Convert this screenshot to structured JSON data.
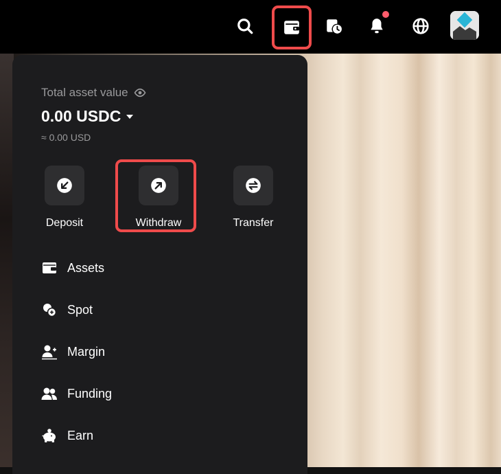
{
  "topbar": {
    "icons": [
      "search-icon",
      "wallet-icon",
      "order-history-icon",
      "notification-bell-icon",
      "globe-icon",
      "avatar"
    ],
    "notification_dot_color": "#ff5c6c",
    "highlight_color": "#ef4b4b"
  },
  "wallet": {
    "total_label": "Total asset value",
    "balance": "0.00 USDC",
    "approx": "≈ 0.00 USD"
  },
  "actions": [
    {
      "label": "Deposit",
      "icon": "deposit-icon"
    },
    {
      "label": "Withdraw",
      "icon": "withdraw-icon"
    },
    {
      "label": "Transfer",
      "icon": "transfer-icon"
    }
  ],
  "menu": [
    {
      "label": "Assets",
      "icon": "assets-icon"
    },
    {
      "label": "Spot",
      "icon": "spot-icon"
    },
    {
      "label": "Margin",
      "icon": "margin-icon"
    },
    {
      "label": "Funding",
      "icon": "funding-icon"
    },
    {
      "label": "Earn",
      "icon": "earn-icon"
    }
  ]
}
